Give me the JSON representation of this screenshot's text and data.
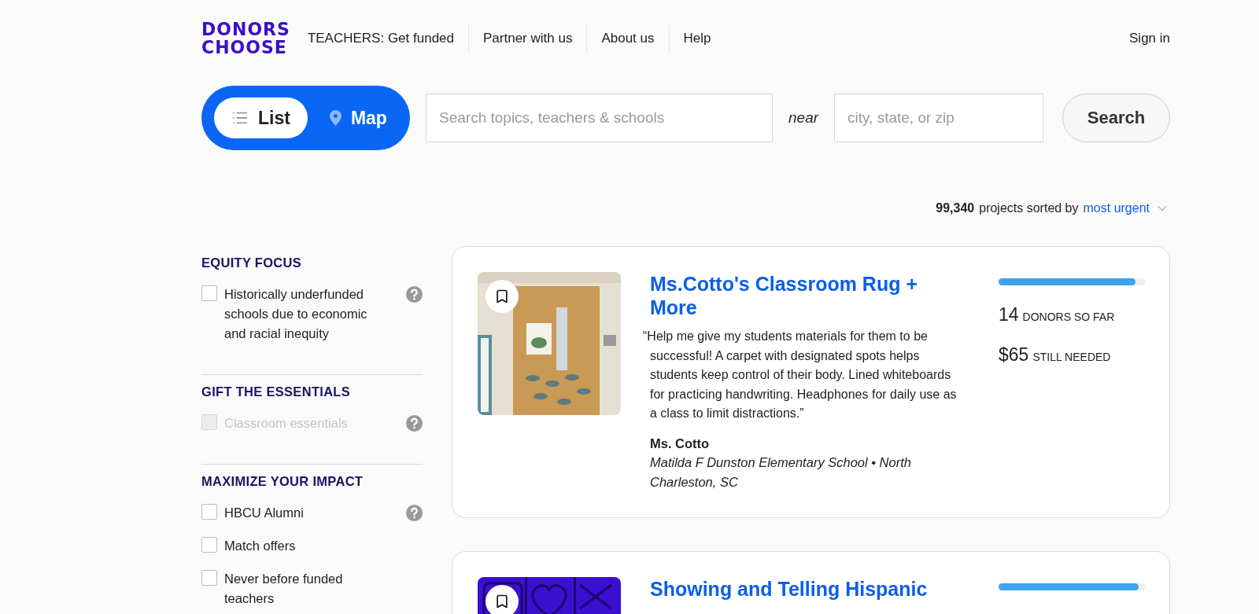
{
  "logo": {
    "line1": "DONORS",
    "line2": "CHOOSE"
  },
  "nav": [
    "TEACHERS: Get funded",
    "Partner with us",
    "About us",
    "Help"
  ],
  "sign_in": "Sign in",
  "view_toggle": [
    {
      "kind": "list",
      "label": "List",
      "selected": true
    },
    {
      "kind": "map",
      "label": "Map",
      "selected": false
    }
  ],
  "search": {
    "placeholder": "Search topics, teachers & schools"
  },
  "near_label": "near",
  "location": {
    "placeholder": "city, state, or zip"
  },
  "search_button": "Search",
  "results": {
    "count": "99,340",
    "text": "projects sorted by",
    "sort": "most urgent"
  },
  "filters": [
    {
      "heading": "EQUITY FOCUS",
      "items": [
        {
          "label": "Historically underfunded schools due to economic and racial inequity",
          "checked": false,
          "disabled": false,
          "help": true
        }
      ]
    },
    {
      "heading": "GIFT THE ESSENTIALS",
      "items": [
        {
          "label": "Classroom essentials",
          "checked": false,
          "disabled": true,
          "help": true
        }
      ]
    },
    {
      "heading": "MAXIMIZE YOUR IMPACT",
      "items": [
        {
          "label": "HBCU Alumni",
          "checked": false,
          "disabled": false,
          "help": true
        },
        {
          "label": "Match offers",
          "checked": false,
          "disabled": false,
          "help": false
        },
        {
          "label": "Never before funded teachers",
          "checked": false,
          "disabled": false,
          "help": false
        }
      ]
    }
  ],
  "projects": [
    {
      "title": "Ms.Cotto's Classroom Rug + More",
      "quote": "“Help me give my students materials for them to be successful! A carpet with designated spots helps students keep control of their body. Lined whiteboards for practicing handwriting. Headphones for daily use as a class to limit distractions.”",
      "teacher": "Ms. Cotto",
      "school": "Matilda F Dunston Elementary School • North Charleston, SC",
      "level": 0.93,
      "donors": "14",
      "donors_label": "DONORS SO FAR",
      "needed": "$65",
      "needed_label": "STILL NEEDED"
    },
    {
      "title": "Showing and Telling Hispanic",
      "level": 0.95
    }
  ]
}
